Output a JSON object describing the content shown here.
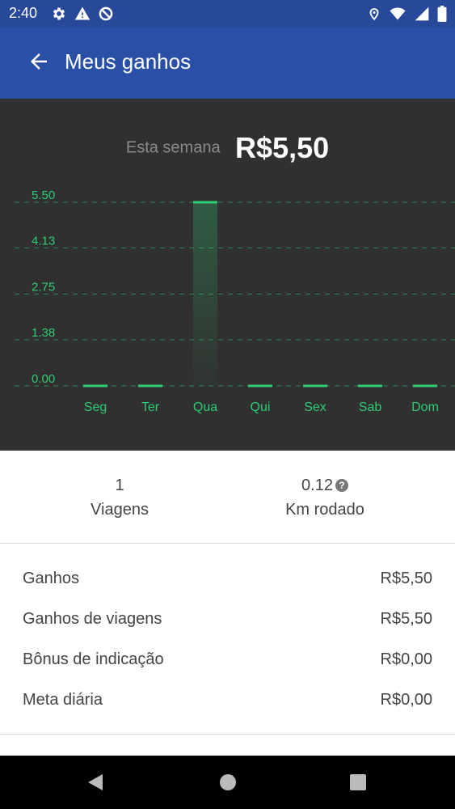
{
  "status_bar": {
    "time": "2:40",
    "left_icons": [
      "gear-icon",
      "warning-icon",
      "blocked-icon"
    ],
    "right_icons": [
      "location-icon",
      "wifi-icon",
      "signal-icon",
      "battery-icon"
    ]
  },
  "app_bar": {
    "title": "Meus ganhos",
    "back_icon": "arrow-left-icon"
  },
  "summary": {
    "label": "Esta semana",
    "amount": "R$5,50"
  },
  "chart_data": {
    "type": "bar",
    "categories": [
      "Seg",
      "Ter",
      "Qua",
      "Qui",
      "Sex",
      "Sab",
      "Dom"
    ],
    "values": [
      0,
      0,
      5.5,
      0,
      0,
      0,
      0
    ],
    "y_ticks": [
      "0.00",
      "1.38",
      "2.75",
      "4.13",
      "5.50"
    ],
    "ylim": [
      0,
      5.5
    ],
    "grid": true,
    "accent_color": "#2ecc71"
  },
  "stats": {
    "trips_value": "1",
    "trips_label": "Viagens",
    "km_value": "0.12",
    "km_label": "Km rodado",
    "km_help_icon": "question-circle-icon",
    "km_help_glyph": "?"
  },
  "earnings": [
    {
      "label": "Ganhos",
      "value": "R$5,50"
    },
    {
      "label": "Ganhos de viagens",
      "value": "R$5,50"
    },
    {
      "label": "Bônus de indicação",
      "value": "R$0,00"
    },
    {
      "label": "Meta diária",
      "value": "R$0,00"
    }
  ],
  "nav_bar": {
    "icons": [
      "back-triangle-icon",
      "home-circle-icon",
      "recents-square-icon"
    ]
  },
  "colors": {
    "status_bar": "#28489a",
    "app_bar": "#2a4fa6",
    "chart_bg": "#303030",
    "accent": "#2ecc71"
  }
}
